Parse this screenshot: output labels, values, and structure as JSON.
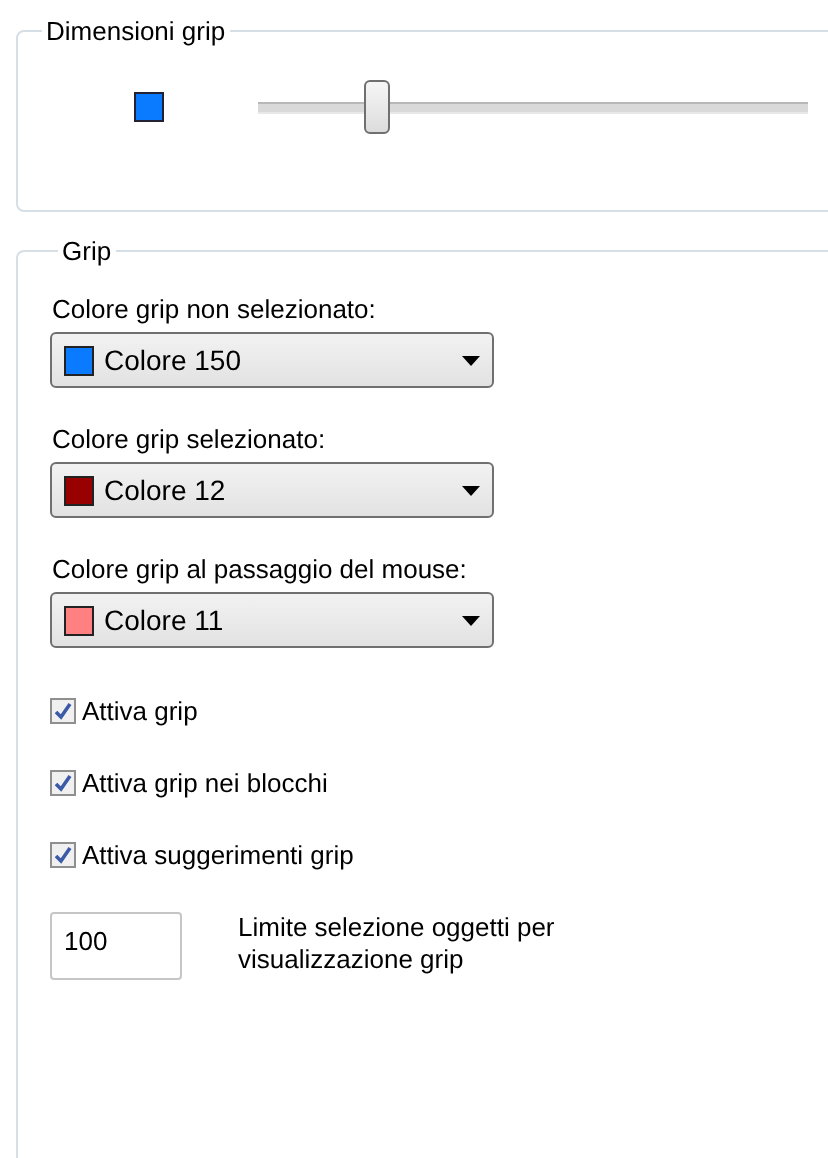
{
  "grip_size": {
    "title": "Dimensioni grip",
    "color": "#0a7aff",
    "level": 0.21
  },
  "grip": {
    "title": "Grip",
    "dropdowns": [
      {
        "label": "Colore grip non selezionato:",
        "value": "Colore 150",
        "color": "#0a7aff"
      },
      {
        "label": "Colore grip selezionato:",
        "value": "Colore 12",
        "color": "#990000"
      },
      {
        "label": "Colore grip al passaggio del mouse:",
        "value": "Colore 11",
        "color": "#ff8080"
      }
    ],
    "checkboxes": [
      {
        "label": "Attiva grip",
        "checked": true
      },
      {
        "label": "Attiva grip nei blocchi",
        "checked": true
      },
      {
        "label": "Attiva suggerimenti grip",
        "checked": true
      }
    ],
    "limit": {
      "value": "100",
      "label": "Limite selezione oggetti per visualizzazione grip"
    }
  }
}
